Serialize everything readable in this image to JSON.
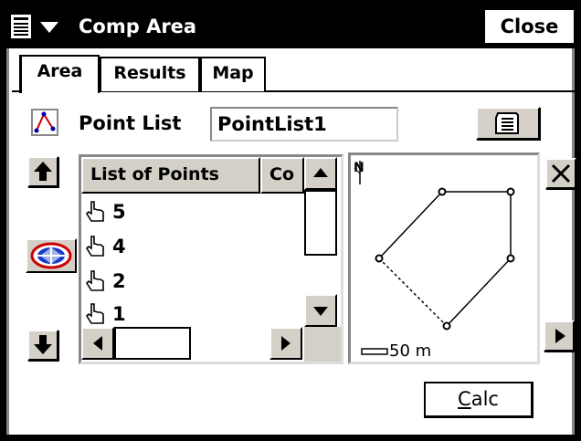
{
  "window": {
    "title": "Comp Area",
    "close_label": "Close"
  },
  "tabs": [
    {
      "label": "Area",
      "active": true
    },
    {
      "label": "Results",
      "active": false
    },
    {
      "label": "Map",
      "active": false
    }
  ],
  "point_list": {
    "label": "Point List",
    "value": "PointList1"
  },
  "list": {
    "columns": [
      "List of Points",
      "Co"
    ],
    "rows": [
      "5",
      "4",
      "2",
      "1"
    ]
  },
  "map": {
    "north_label": "N",
    "scale_label": "50 m"
  },
  "buttons": {
    "calc_first": "C",
    "calc_rest": "alc"
  },
  "icons": {
    "start": "windows-start-icon",
    "point_list": "polyline-icon",
    "list_picker": "list-picker-icon",
    "move_up": "arrow-up-icon",
    "move_down": "arrow-down-icon",
    "globe": "globe-icon",
    "clear": "x-icon",
    "play": "play-icon",
    "point": "hand-point-icon"
  }
}
